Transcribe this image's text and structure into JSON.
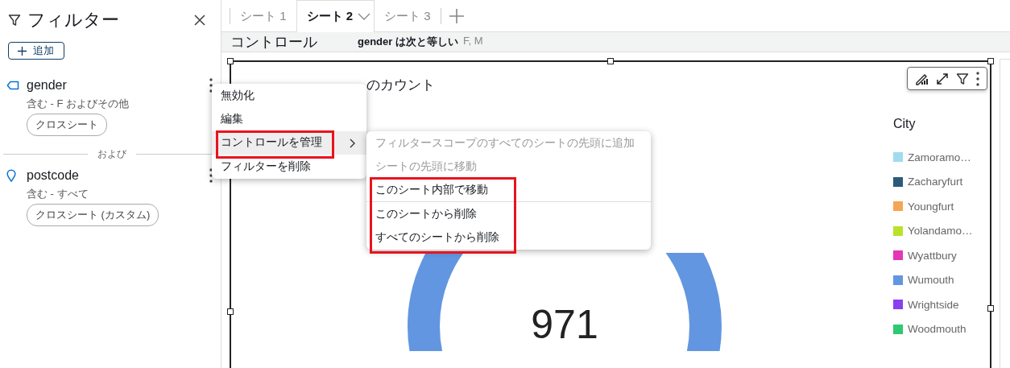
{
  "filter_panel": {
    "title": "フィルター",
    "add_button": "追加",
    "filters": [
      {
        "kind": "tag",
        "name": "gender",
        "condition": "含む - F およびその他",
        "scope": "クロスシート"
      },
      {
        "kind": "pin",
        "name": "postcode",
        "condition": "含む - すべて",
        "scope": "クロスシート (カスタム)"
      }
    ],
    "separator": "および"
  },
  "tabs": [
    {
      "label": "シート 1",
      "selected": false
    },
    {
      "label": "シート 2",
      "selected": true
    },
    {
      "label": "シート 3",
      "selected": false
    }
  ],
  "controls_bar": {
    "title": "コントロール",
    "filter_label": "gender は次と等しい",
    "filter_value": "F, M"
  },
  "visual": {
    "title": "のカウント",
    "value": "971",
    "legend": {
      "title": "City",
      "items": [
        {
          "label": "Zamoramo…",
          "color": "#9fdcf0"
        },
        {
          "label": "Zacharyfurt",
          "color": "#2b5b79"
        },
        {
          "label": "Youngfurt",
          "color": "#f5a654"
        },
        {
          "label": "Yolandamo…",
          "color": "#b9e22b"
        },
        {
          "label": "Wyattbury",
          "color": "#e437b5"
        },
        {
          "label": "Wumouth",
          "color": "#6396e0"
        },
        {
          "label": "Wrightside",
          "color": "#8a3ff1"
        },
        {
          "label": "Woodmouth",
          "color": "#2fc873"
        }
      ]
    }
  },
  "context_menu": {
    "items": [
      {
        "label": "無効化",
        "selected": false,
        "annotated": false,
        "has_submenu": false
      },
      {
        "label": "編集",
        "selected": false,
        "annotated": false,
        "has_submenu": false
      },
      {
        "label": "コントロールを管理",
        "selected": true,
        "annotated": true,
        "has_submenu": true
      },
      {
        "label": "フィルターを削除",
        "selected": false,
        "annotated": false,
        "has_submenu": false
      }
    ]
  },
  "submenu": {
    "items": [
      {
        "label": "フィルタースコープのすべてのシートの先頭に追加",
        "disabled": true,
        "annotated": false,
        "divider_after": false
      },
      {
        "label": "シートの先頭に移動",
        "disabled": true,
        "annotated": false,
        "divider_after": false
      },
      {
        "label": "このシート内部で移動",
        "disabled": false,
        "annotated": true,
        "divider_after": true
      },
      {
        "label": "このシートから削除",
        "disabled": false,
        "annotated": true,
        "divider_after": false
      },
      {
        "label": "すべてのシートから削除",
        "disabled": false,
        "annotated": true,
        "divider_after": false
      }
    ]
  }
}
